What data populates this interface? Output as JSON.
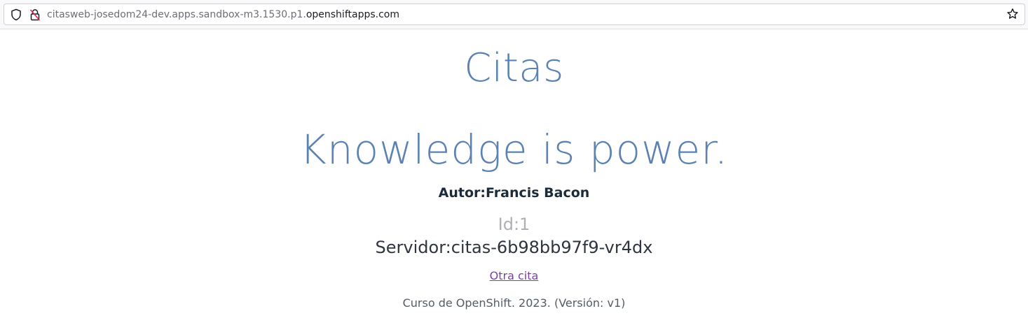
{
  "browser": {
    "url_prefix": "citasweb-josedom24-dev.apps.sandbox-m3.1530.p1.",
    "url_domain": "openshiftapps.com",
    "icons": [
      "shield-icon",
      "insecure-lock-icon",
      "star-icon"
    ]
  },
  "page": {
    "title": "Citas",
    "quote": "Knowledge is power.",
    "author": "Autor:Francis Bacon",
    "id": "Id:1",
    "server": "Servidor:citas-6b98bb97f9-vr4dx",
    "next_link": "Otra cita",
    "footer": "Curso de OpenShift. 2023. (Versión: v1)"
  },
  "colors": {
    "title": "#5b82b3",
    "link": "#7b3fa8",
    "id_text": "#b0b0b4"
  }
}
